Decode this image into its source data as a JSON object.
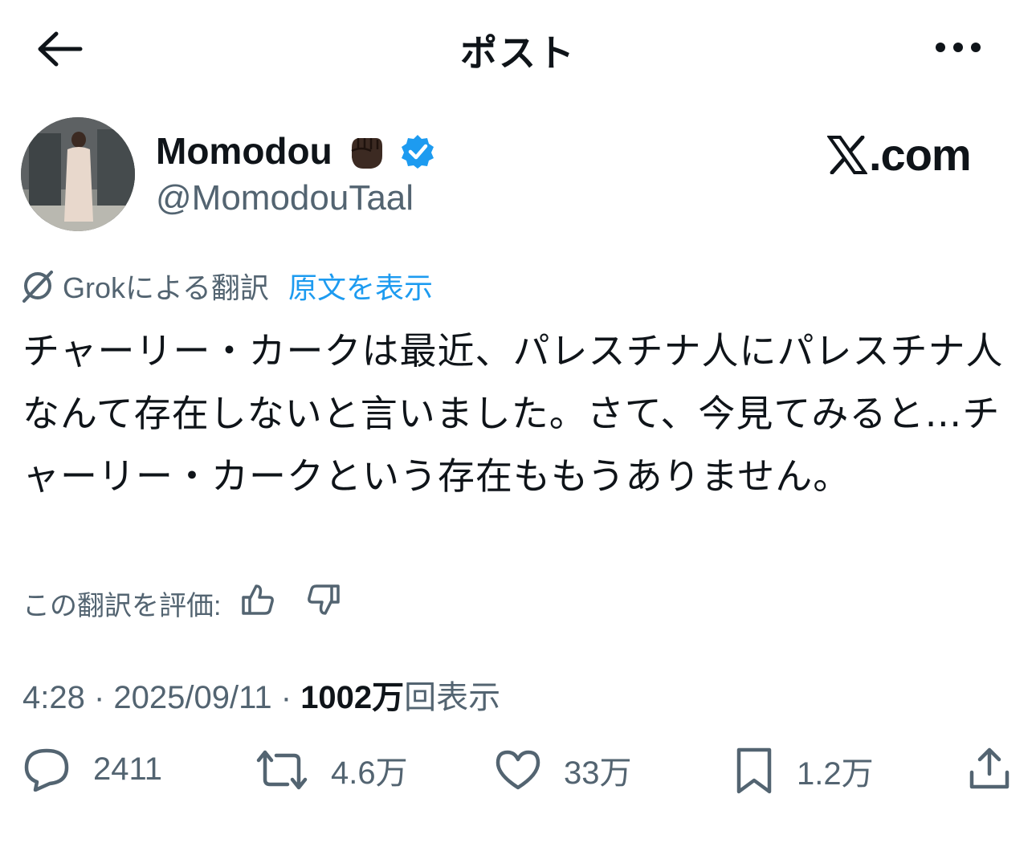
{
  "header": {
    "title": "ポスト",
    "back_icon": "arrow-left-icon",
    "more_icon": "more-horizontal-icon"
  },
  "author": {
    "name": "Momodou",
    "emoji": "✊🏿",
    "handle": "@MomodouTaal",
    "verified": true,
    "verified_color": "#1d9bf0"
  },
  "watermark": {
    "text": ".com",
    "logo": "x-logo-icon"
  },
  "translation": {
    "label": "Grokによる翻訳",
    "show_original": "原文を表示",
    "rate_label": "この翻訳を評価:"
  },
  "post": {
    "text": " チャーリー・カークは最近、パレスチナ人にパレスチナ人なんて存在しないと言いました。さて、今見てみると…チャーリー・カークという存在ももうありません。"
  },
  "meta": {
    "time": "4:28",
    "sep1": " · ",
    "date": "2025/09/11",
    "sep2": " · ",
    "views_num": "1002万",
    "views_label": "回表示"
  },
  "actions": {
    "replies": "2411",
    "reposts": "4.6万",
    "likes": "33万",
    "bookmarks": "1.2万"
  },
  "colors": {
    "text": "#0f1419",
    "secondary": "#536471",
    "accent": "#1d9bf0"
  }
}
